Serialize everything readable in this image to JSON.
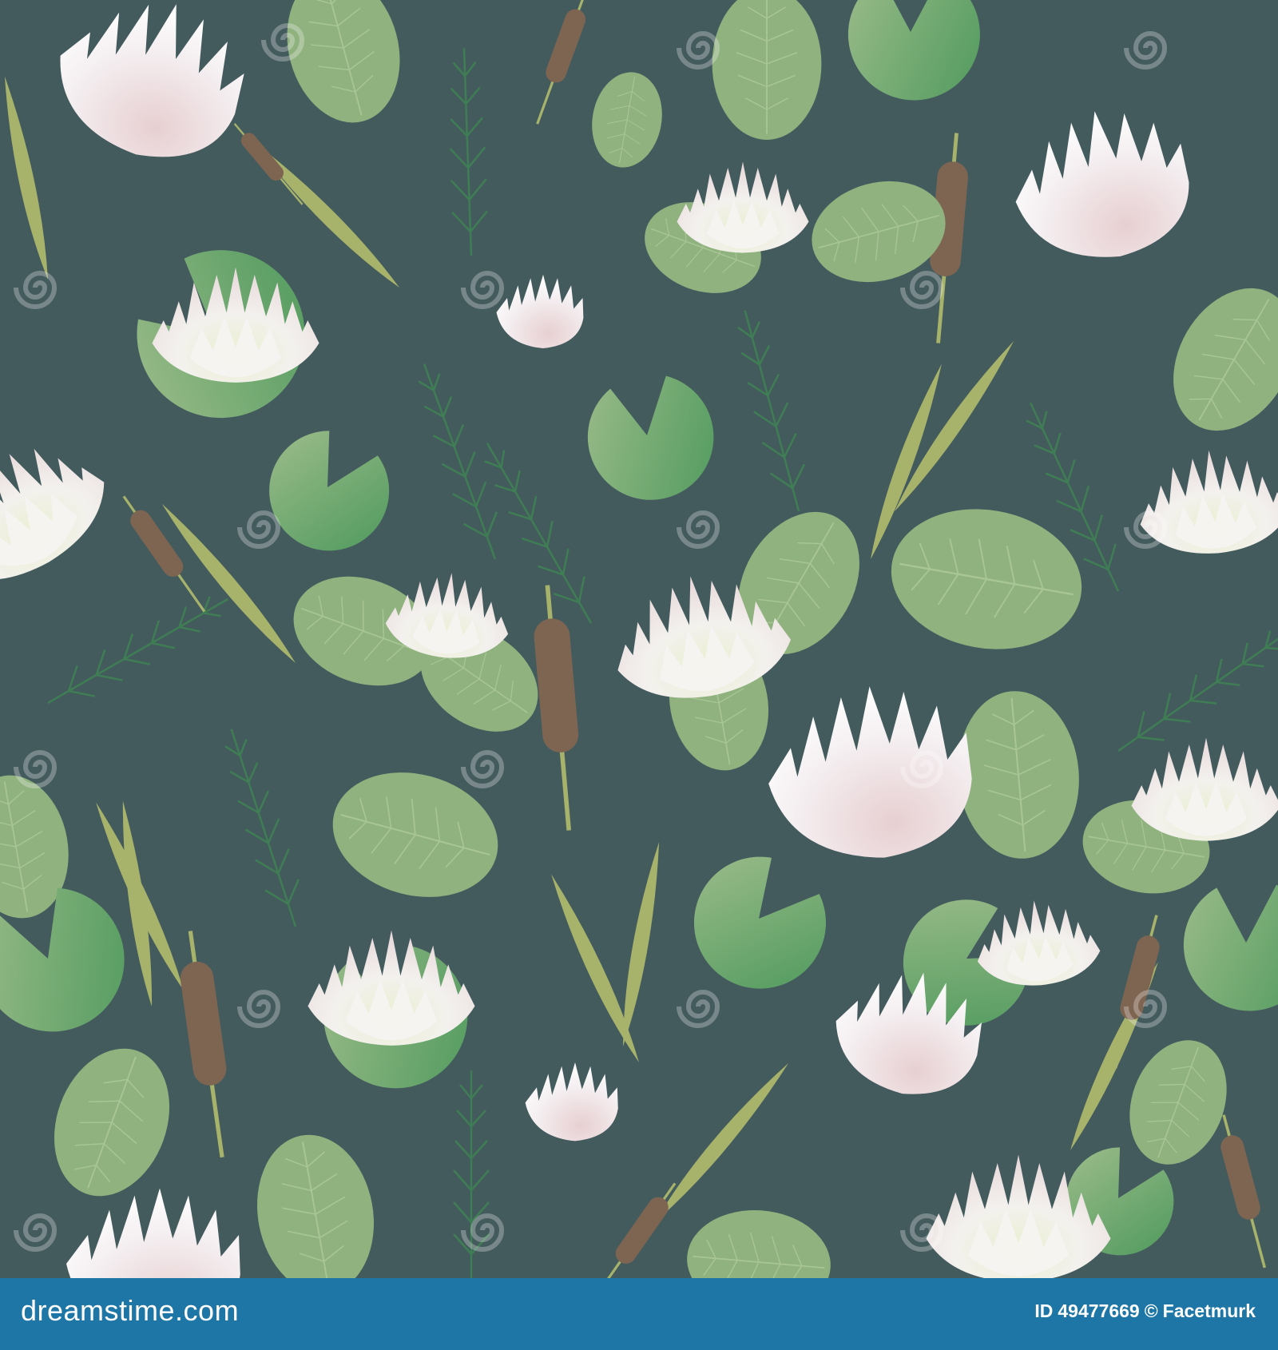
{
  "image": {
    "background_color": "#445b5e",
    "motif": "seamless pond pattern: water lilies, lily pads, cattails, reeds, horsetail sprigs",
    "watermark_text": "dreamstime",
    "colors": {
      "pad_light": "#8fb27e",
      "pad_dark": "#3f8a52",
      "petal": "#f1ece9",
      "petal_pink": "#e5cfd0",
      "reed": "#a7b36b",
      "cattail": "#7e6552",
      "sprig": "#3f7d54"
    }
  },
  "footer": {
    "background_color": "#1e76a6",
    "brand": "dreamstime.com",
    "id_label": "ID",
    "id_number": "49477669",
    "copyright_symbol": "©",
    "author": "Facetmurk"
  }
}
